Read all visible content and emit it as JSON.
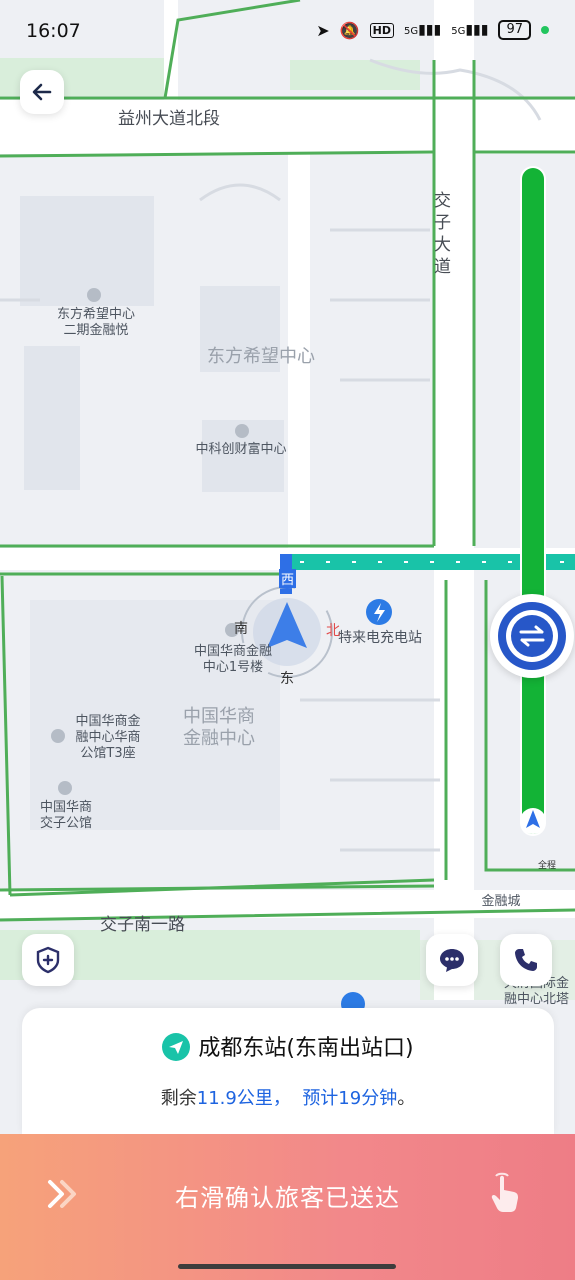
{
  "status_bar": {
    "time": "16:07",
    "battery": "97",
    "network1": "5G",
    "network2": "5G",
    "hd": "HD"
  },
  "map": {
    "road_labels": {
      "north_road": "益州大道北段",
      "east_road": "交子大道",
      "south_road": "交子南一路"
    },
    "area_labels": {
      "top_area": "东方希望中心",
      "bottom_area": "中国华商\n金融中心"
    },
    "pois": {
      "poi1": "东方希望中心\n二期金融悦",
      "poi2": "中科创财富中心",
      "poi3": "中国华商金融\n中心1号楼",
      "poi4": "中国华商金\n融中心华商\n公馆T3座",
      "poi5": "中国华商\n交子公馆",
      "poi6": "特来电充电站",
      "poi7": "金融城",
      "poi8": "天府国际金\n融中心北塔"
    },
    "compass": {
      "west": "西",
      "north": "北",
      "south": "南",
      "east": "东"
    },
    "overview_label": "全程"
  },
  "destination": {
    "name": "成都东站(东南出站口)"
  },
  "trip": {
    "prefix": "剩余",
    "distance": "11.9公里，",
    "estimate": "预计19分钟",
    "suffix": "。"
  },
  "slide": {
    "label": "右滑确认旅客已送达"
  },
  "colors": {
    "route_green": "#13b336",
    "route_teal": "#19c3a8",
    "accent_blue": "#1e64e0",
    "slide_start": "#f6a27a",
    "slide_end": "#ee7d86"
  }
}
